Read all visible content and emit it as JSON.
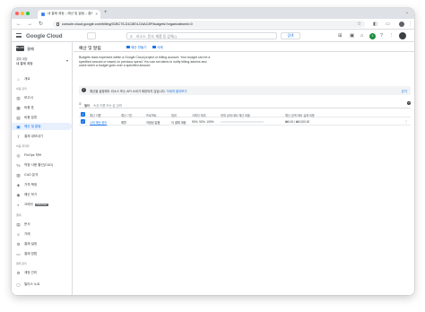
{
  "browser": {
    "tab_title": "내 결제 계정 – 예산 및 알림 – 결제 – Google Cloud",
    "url": "console.cloud.google.com/billing/01BC75-D1C8E4-D4AC8F/budgets?organizationId=0"
  },
  "header": {
    "logo_text": "Google Cloud",
    "search_placeholder": "리소스, 문서, 제품 등 검색(/)",
    "search_button": "검색",
    "badge": "1"
  },
  "sidebar": {
    "app_title": "결제",
    "logo_text": "BILLING",
    "account_label": "결제 계정",
    "account_name": "내 결제 계정",
    "sections": [
      {
        "title": "",
        "items": [
          {
            "label": "개요",
            "icon": "home-icon"
          }
        ]
      },
      {
        "title": "비용 관리",
        "items": [
          {
            "label": "보고서",
            "icon": "bar-chart-icon"
          },
          {
            "label": "비용 표",
            "icon": "table-icon"
          },
          {
            "label": "비용 분류",
            "icon": "breakdown-icon"
          },
          {
            "label": "예산 및 알림",
            "icon": "bell-icon",
            "active": true
          },
          {
            "label": "결제 내보내기",
            "icon": "export-icon"
          }
        ]
      },
      {
        "title": "비용 최적화",
        "items": [
          {
            "label": "FinOps 허브",
            "icon": "hub-icon"
          },
          {
            "label": "약정 사용 할인(CUD)",
            "icon": "percent-icon"
          },
          {
            "label": "CUD 분석",
            "icon": "analysis-icon"
          },
          {
            "label": "가격 책정",
            "icon": "price-tag-icon"
          },
          {
            "label": "예산 보기",
            "icon": "eye-icon"
          },
          {
            "label": "크레딧",
            "icon": "credit-icon",
            "badge": "PREVIEW"
          }
        ]
      },
      {
        "title": "결제",
        "items": [
          {
            "label": "문서",
            "icon": "document-icon"
          },
          {
            "label": "거래",
            "icon": "transactions-icon"
          },
          {
            "label": "결제 설정",
            "icon": "settings-icon"
          },
          {
            "label": "결제 방법",
            "icon": "card-icon"
          }
        ]
      },
      {
        "title": "결제 관리",
        "items": [
          {
            "label": "계정 관리",
            "icon": "gear-icon"
          }
        ]
      }
    ],
    "footer": "릴리스 노트"
  },
  "main": {
    "title": "예산 및 알림",
    "create_button": "예산 만들기",
    "delete_button": "삭제",
    "intro_text": "Budgets track expenses within a Google Cloud project or billing account. Your budget can be a specified amount or based on previous spend. You can set alerts to notify billing admins and users when a budget goes over a specified amount.",
    "banner_text": "예산을 설정해도 리소스 또는 API 소비가 제한되지 않습니다.",
    "banner_link": "자세히 알아보기",
    "banner_close": "닫기",
    "filter_label": "필터",
    "filter_placeholder": "속성 이름 또는 값 입력",
    "table": {
      "columns": [
        "예산 이름",
        "예산 기간",
        "프로젝트",
        "범위",
        "크레딧 제외",
        "현재 상태 대비 예산 비율",
        "예산 금액 대비 실제 비용"
      ],
      "rows": [
        {
          "name": "나의 예산 한도",
          "period": "매월",
          "project": "지정된 없음",
          "scope": "이 결제 계정",
          "credits": "50%, 90%, 100%",
          "progress": 0.0,
          "amount": "₩0.00 / ₩2,000.00"
        }
      ]
    }
  }
}
